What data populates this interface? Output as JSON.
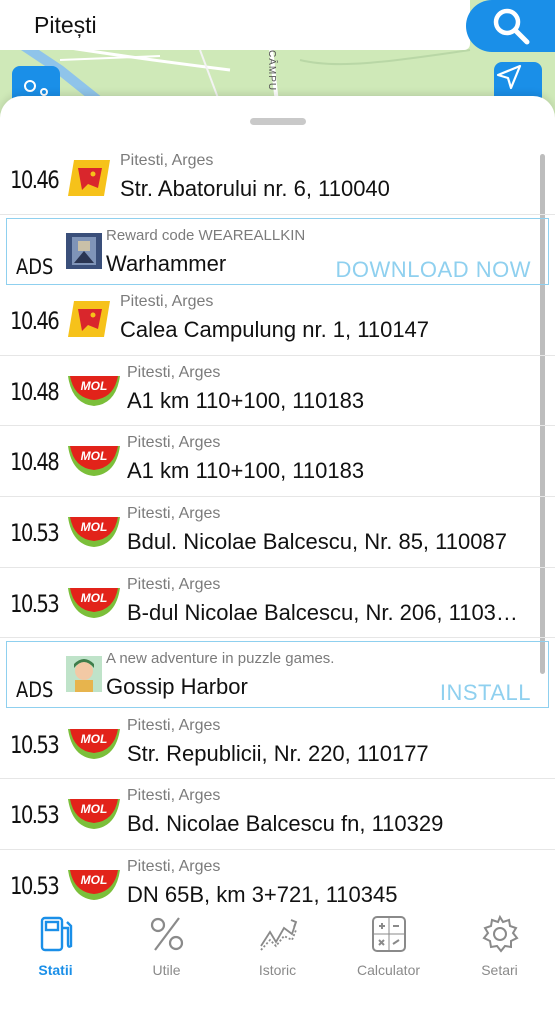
{
  "search": {
    "value": "Pitești"
  },
  "map": {
    "street_label": "CÂMPU"
  },
  "list": [
    {
      "kind": "station",
      "brand": "petrom",
      "price": "10.46",
      "city": "Pitesti, Arges",
      "address": "Str. Abatorului nr. 6, 110040"
    },
    {
      "kind": "ad",
      "tag": "ADS",
      "subtitle": "Reward code WEAREALLKIN",
      "title": "Warhammer",
      "cta": "DOWNLOAD NOW",
      "thumb": "warhammer-game-icon"
    },
    {
      "kind": "station",
      "brand": "petrom",
      "price": "10.46",
      "city": "Pitesti, Arges",
      "address": "Calea Campulung nr. 1, 110147"
    },
    {
      "kind": "station",
      "brand": "mol",
      "price": "10.48",
      "city": "Pitesti, Arges",
      "address": "A1 km 110+100, 110183"
    },
    {
      "kind": "station",
      "brand": "mol",
      "price": "10.48",
      "city": "Pitesti, Arges",
      "address": "A1 km 110+100, 110183"
    },
    {
      "kind": "station",
      "brand": "mol",
      "price": "10.53",
      "city": "Pitesti, Arges",
      "address": "Bdul. Nicolae Balcescu, Nr. 85, 110087"
    },
    {
      "kind": "station",
      "brand": "mol",
      "price": "10.53",
      "city": "Pitesti, Arges",
      "address": "B-dul Nicolae Balcescu, Nr. 206, 1103…"
    },
    {
      "kind": "ad",
      "tag": "ADS",
      "subtitle": "A new adventure in puzzle games.",
      "title": "Gossip Harbor",
      "cta": "INSTALL",
      "thumb": "gossip-harbor-game-icon"
    },
    {
      "kind": "station",
      "brand": "mol",
      "price": "10.53",
      "city": "Pitesti, Arges",
      "address": "Str. Republicii, Nr. 220, 110177"
    },
    {
      "kind": "station",
      "brand": "mol",
      "price": "10.53",
      "city": "Pitesti, Arges",
      "address": "Bd. Nicolae Balcescu fn, 110329"
    },
    {
      "kind": "station",
      "brand": "mol",
      "price": "10.53",
      "city": "Pitesti, Arges",
      "address": "DN 65B, km 3+721, 110345"
    }
  ],
  "tabs": [
    {
      "label": "Statii",
      "icon": "fuel-pump-icon",
      "active": true
    },
    {
      "label": "Utile",
      "icon": "percent-icon",
      "active": false
    },
    {
      "label": "Istoric",
      "icon": "trend-chart-icon",
      "active": false
    },
    {
      "label": "Calculator",
      "icon": "calculator-icon",
      "active": false
    },
    {
      "label": "Setari",
      "icon": "gear-icon",
      "active": false
    }
  ],
  "colors": {
    "accent": "#1a8fe8",
    "ad_border": "#8fd0ef",
    "petrom_yellow": "#f6c21a",
    "petrom_red": "#d9262c",
    "mol_red": "#e2231a",
    "mol_green": "#7bbf3a"
  }
}
